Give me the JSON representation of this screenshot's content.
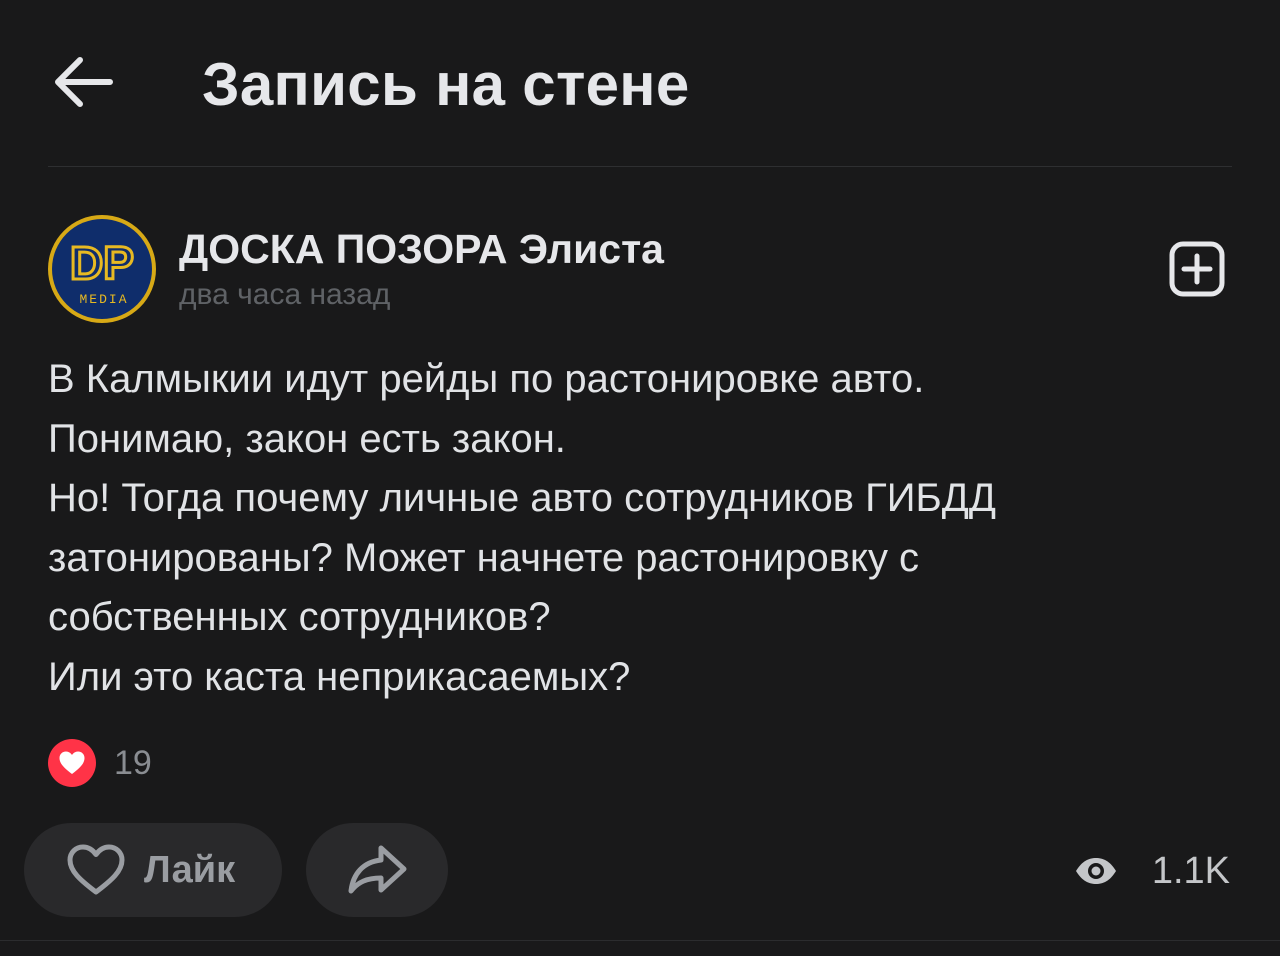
{
  "header": {
    "back_icon": "arrow-left-icon",
    "title": "Запись на стене"
  },
  "post": {
    "author": "ДОСКА ПОЗОРА Элиста",
    "avatar": {
      "monogram": "DP",
      "caption": "MEDIA",
      "ring_color": "#d7a916",
      "bg_color": "#0f2d6b"
    },
    "time": "два часа назад",
    "subscribe_icon": "plus-square-icon",
    "text_lines": [
      "В Калмыкии идут рейды по растонировке авто.",
      "Понимаю, закон есть закон.",
      "Но! Тогда почему личные авто сотрудников ГИБДД",
      "затонированы? Может начнете растонировку с",
      "собственных сотрудников?",
      "Или это каста неприкасаемых?"
    ]
  },
  "reactions": {
    "icon": "heart-filled-icon",
    "count": "19",
    "color": "#ff3347"
  },
  "actions": {
    "like_label": "Лайк",
    "like_icon": "heart-outline-icon",
    "share_icon": "share-arrow-icon"
  },
  "views": {
    "icon": "eye-icon",
    "count": "1.1K"
  },
  "colors": {
    "background": "#19191a",
    "text": "#e1e3e6",
    "secondary": "#5f6266",
    "pill": "#29292b"
  }
}
